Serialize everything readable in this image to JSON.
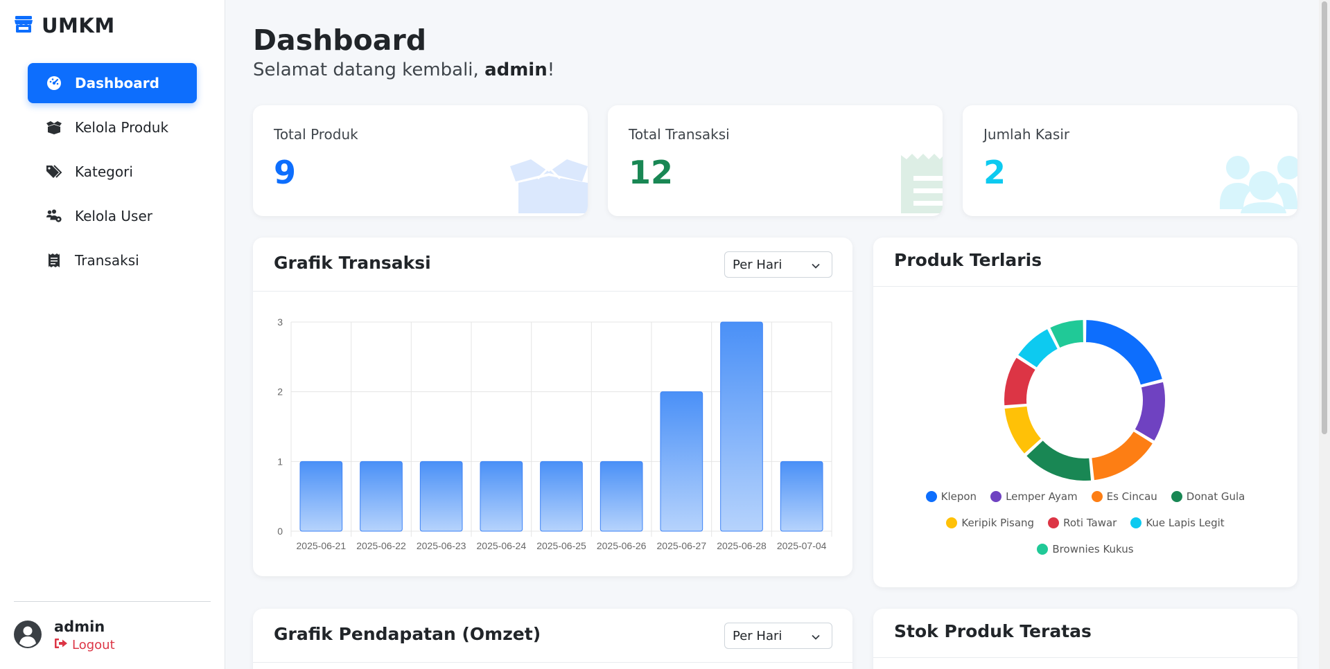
{
  "brand": {
    "name": "UMKM",
    "color": "#0d6efd"
  },
  "sidebar": {
    "items": [
      {
        "label": "Dashboard",
        "icon": "gauge-icon",
        "active": true
      },
      {
        "label": "Kelola Produk",
        "icon": "box-open-icon",
        "active": false
      },
      {
        "label": "Kategori",
        "icon": "tags-icon",
        "active": false
      },
      {
        "label": "Kelola User",
        "icon": "users-gear-icon",
        "active": false
      },
      {
        "label": "Transaksi",
        "icon": "receipt-icon",
        "active": false
      }
    ],
    "user": {
      "name": "admin",
      "logout_label": "Logout"
    }
  },
  "header": {
    "title": "Dashboard",
    "welcome_prefix": "Selamat datang kembali, ",
    "welcome_user": "admin",
    "welcome_suffix": "!"
  },
  "stats": [
    {
      "label": "Total Produk",
      "value": "9",
      "color": "#0d6efd",
      "icon": "box-open-icon"
    },
    {
      "label": "Total Transaksi",
      "value": "12",
      "color": "#198754",
      "icon": "receipt-icon"
    },
    {
      "label": "Jumlah Kasir",
      "value": "2",
      "color": "#0dcaf0",
      "icon": "users-icon"
    }
  ],
  "transactions_card": {
    "title": "Grafik Transaksi",
    "period": "Per Hari"
  },
  "bestseller_card": {
    "title": "Produk Terlaris"
  },
  "revenue_card": {
    "title": "Grafik Pendapatan (Omzet)",
    "period": "Per Hari"
  },
  "stock_card": {
    "title": "Stok Produk Teratas"
  },
  "chart_data": [
    {
      "type": "bar",
      "categories": [
        "2025-06-21",
        "2025-06-22",
        "2025-06-23",
        "2025-06-24",
        "2025-06-25",
        "2025-06-26",
        "2025-06-27",
        "2025-06-28",
        "2025-07-04"
      ],
      "values": [
        1,
        1,
        1,
        1,
        1,
        1,
        2,
        3,
        1
      ],
      "ylim": [
        0,
        3
      ],
      "yticks": [
        "0",
        "1",
        "2",
        "3"
      ],
      "grid": true,
      "color": "#4a90f7"
    },
    {
      "type": "pie",
      "labels": [
        "Klepon",
        "Lemper Ayam",
        "Es Cincau",
        "Donat Gula",
        "Keripik Pisang",
        "Roti Tawar",
        "Kue Lapis Legit",
        "Brownies Kukus"
      ],
      "values": [
        2,
        1.2,
        1.4,
        1.4,
        1,
        1,
        0.8,
        0.7
      ],
      "colors": [
        "#0d6efd",
        "#6f42c1",
        "#fd7e14",
        "#198754",
        "#ffc107",
        "#dc3545",
        "#0dcaf0",
        "#20c997"
      ],
      "legend": "bottom",
      "donut": true
    }
  ]
}
